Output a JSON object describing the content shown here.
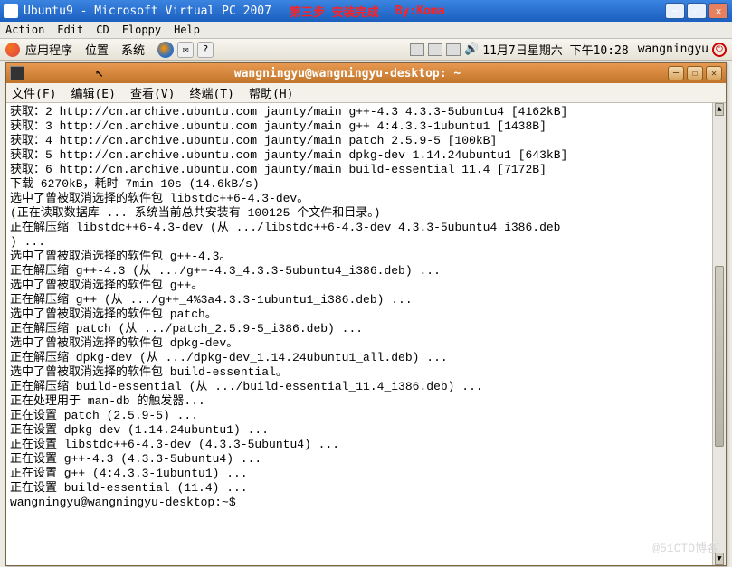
{
  "outer_window": {
    "title": "Ubuntu9 - Microsoft Virtual PC 2007",
    "red_annotation_1": "第三步 安装完成",
    "red_annotation_2": "By:Koma",
    "menu": {
      "action": "Action",
      "edit": "Edit",
      "cd": "CD",
      "floppy": "Floppy",
      "help": "Help"
    }
  },
  "gnome_panel": {
    "applications": "应用程序",
    "places": "位置",
    "system": "系统",
    "clock": "11月7日星期六 下午10:28",
    "username": "wangningyu"
  },
  "terminal_window": {
    "title": "wangningyu@wangningyu-desktop: ~",
    "menu": {
      "file": "文件(F)",
      "edit": "编辑(E)",
      "view": "查看(V)",
      "terminal": "终端(T)",
      "help": "帮助(H)"
    }
  },
  "terminal_lines": [
    "获取：2 http://cn.archive.ubuntu.com jaunty/main g++-4.3 4.3.3-5ubuntu4 [4162kB]",
    "获取：3 http://cn.archive.ubuntu.com jaunty/main g++ 4:4.3.3-1ubuntu1 [1438B]",
    "获取：4 http://cn.archive.ubuntu.com jaunty/main patch 2.5.9-5 [100kB]",
    "获取：5 http://cn.archive.ubuntu.com jaunty/main dpkg-dev 1.14.24ubuntu1 [643kB]",
    "获取：6 http://cn.archive.ubuntu.com jaunty/main build-essential 11.4 [7172B]",
    "下载 6270kB，耗时 7min 10s (14.6kB/s)",
    "选中了曾被取消选择的软件包 libstdc++6-4.3-dev。",
    "(正在读取数据库 ... 系统当前总共安装有 100125 个文件和目录。)",
    "正在解压缩 libstdc++6-4.3-dev (从 .../libstdc++6-4.3-dev_4.3.3-5ubuntu4_i386.deb",
    ") ...",
    "选中了曾被取消选择的软件包 g++-4.3。",
    "正在解压缩 g++-4.3 (从 .../g++-4.3_4.3.3-5ubuntu4_i386.deb) ...",
    "选中了曾被取消选择的软件包 g++。",
    "正在解压缩 g++ (从 .../g++_4%3a4.3.3-1ubuntu1_i386.deb) ...",
    "选中了曾被取消选择的软件包 patch。",
    "正在解压缩 patch (从 .../patch_2.5.9-5_i386.deb) ...",
    "选中了曾被取消选择的软件包 dpkg-dev。",
    "正在解压缩 dpkg-dev (从 .../dpkg-dev_1.14.24ubuntu1_all.deb) ...",
    "选中了曾被取消选择的软件包 build-essential。",
    "正在解压缩 build-essential (从 .../build-essential_11.4_i386.deb) ...",
    "正在处理用于 man-db 的触发器...",
    "正在设置 patch (2.5.9-5) ...",
    "正在设置 dpkg-dev (1.14.24ubuntu1) ...",
    "正在设置 libstdc++6-4.3-dev (4.3.3-5ubuntu4) ...",
    "正在设置 g++-4.3 (4.3.3-5ubuntu4) ...",
    "正在设置 g++ (4:4.3.3-1ubuntu1) ...",
    "",
    "正在设置 build-essential (11.4) ...",
    "wangningyu@wangningyu-desktop:~$"
  ],
  "watermark": "@51CTO博客"
}
